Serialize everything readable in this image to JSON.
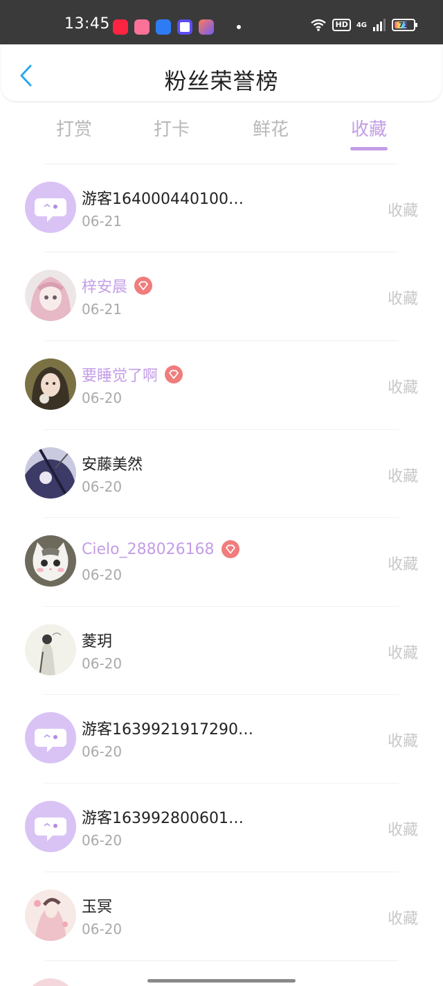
{
  "status_bar": {
    "time": "13:45",
    "network": "4G",
    "hd": "HD",
    "battery": "71",
    "apps": [
      {
        "icon": "xiaohongshu-icon",
        "color": "#ff2442"
      },
      {
        "icon": "bilibili-icon",
        "color": "#fb7299"
      },
      {
        "icon": "cloud-app-icon",
        "color": "#2f7bf5"
      },
      {
        "icon": "circle-app-icon",
        "color": "#5b4cf2"
      },
      {
        "icon": "shortcut-app-icon",
        "color": "#6f5cf6"
      }
    ]
  },
  "header": {
    "title": "粉丝荣誉榜",
    "back_icon": "chevron-left-icon"
  },
  "tabs": [
    {
      "label": "打赏",
      "active": false
    },
    {
      "label": "打卡",
      "active": false
    },
    {
      "label": "鲜花",
      "active": false
    },
    {
      "label": "收藏",
      "active": true
    }
  ],
  "colors": {
    "accent": "#c39de6",
    "vip_badge": "#f07c7c",
    "muted": "#a9a9a9",
    "back": "#2ba7f0"
  },
  "list": [
    {
      "name": "游客164000440100…",
      "date": "06-21",
      "action": "收藏",
      "vip": false,
      "avatar": "guest-avatar"
    },
    {
      "name": "梓安晨",
      "date": "06-21",
      "action": "收藏",
      "vip": true,
      "avatar": "anime-girl-avatar"
    },
    {
      "name": "要睡觉了啊",
      "date": "06-20",
      "action": "收藏",
      "vip": true,
      "avatar": "portrait-avatar"
    },
    {
      "name": "安藤美然",
      "date": "06-20",
      "action": "收藏",
      "vip": false,
      "avatar": "dark-art-avatar"
    },
    {
      "name": "Cielo_288026168",
      "date": "06-20",
      "action": "收藏",
      "vip": true,
      "avatar": "cat-avatar"
    },
    {
      "name": "菱玥",
      "date": "06-20",
      "action": "收藏",
      "vip": false,
      "avatar": "sketch-avatar"
    },
    {
      "name": "游客1639921917290…",
      "date": "06-20",
      "action": "收藏",
      "vip": false,
      "avatar": "guest-avatar"
    },
    {
      "name": "游客163992800601…",
      "date": "06-20",
      "action": "收藏",
      "vip": false,
      "avatar": "guest-avatar"
    },
    {
      "name": "玉冥",
      "date": "06-20",
      "action": "收藏",
      "vip": false,
      "avatar": "pink-art-avatar"
    }
  ]
}
